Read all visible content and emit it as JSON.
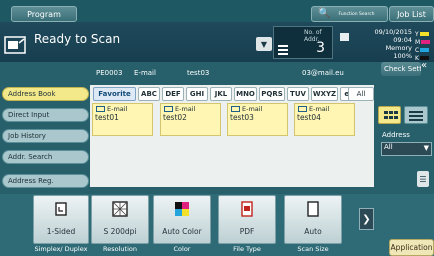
{
  "topbar": {
    "program_label": "Program",
    "search_label": "Function Search",
    "joblist_label": "Job List"
  },
  "status": {
    "title": "Ready to Scan",
    "addr_label": "No. of Addr.",
    "addr_count": "3",
    "date": "09/10/2015",
    "time": "09:04",
    "memory_label": "Memory",
    "memory_value": "100%",
    "toner": [
      "Y",
      "M",
      "C",
      "K"
    ],
    "toner_colors": [
      "#f4e12a",
      "#e0217f",
      "#24a4dc",
      "#111111"
    ],
    "check_setting": "Check Setting"
  },
  "selected": {
    "id": "PE0003",
    "type": "E-mail",
    "name": "test03",
    "email": "03@mail.eu"
  },
  "sidebar": {
    "items": [
      {
        "label": "Address Book"
      },
      {
        "label": "Direct Input"
      },
      {
        "label": "Job History"
      },
      {
        "label": "Addr. Search"
      },
      {
        "label": "Address Reg."
      }
    ]
  },
  "filters": [
    "Favorite",
    "ABC",
    "DEF",
    "GHI",
    "JKL",
    "MNO",
    "PQRS",
    "TUV",
    "WXYZ",
    "etc",
    "All"
  ],
  "cards": [
    {
      "type": "E-mail",
      "name": "test01"
    },
    {
      "type": "E-mail",
      "name": "test02"
    },
    {
      "type": "E-mail",
      "name": "test03"
    },
    {
      "type": "E-mail",
      "name": "test04"
    }
  ],
  "address_select": {
    "label": "Address",
    "value": "All"
  },
  "functions": [
    {
      "value": "1-Sided",
      "caption": "Simplex/ Duplex"
    },
    {
      "value": "S 200dpi",
      "caption": "Resolution"
    },
    {
      "value": "Auto Color",
      "caption": "Color"
    },
    {
      "value": "PDF",
      "caption": "File Type"
    },
    {
      "value": "Auto",
      "caption": "Scan Size"
    }
  ],
  "application_label": "Application"
}
